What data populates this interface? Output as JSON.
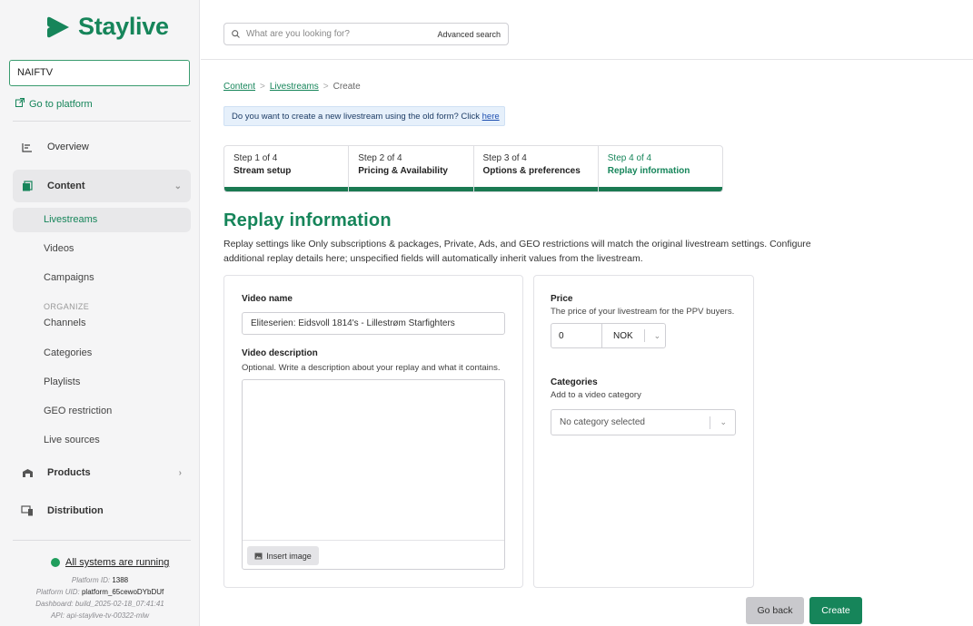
{
  "brand": {
    "name": "Staylive",
    "accent": "#16855a"
  },
  "sidebar": {
    "platform": "NAIFTV",
    "goto_label": "Go to platform",
    "overview": "Overview",
    "content": "Content",
    "sub": {
      "livestreams": "Livestreams",
      "videos": "Videos",
      "campaigns": "Campaigns",
      "organize": "ORGANIZE",
      "channels": "Channels",
      "categories": "Categories",
      "playlists": "Playlists",
      "geo": "GEO restriction",
      "live_sources": "Live sources"
    },
    "products": "Products",
    "distribution": "Distribution",
    "status": "All systems are running",
    "meta": {
      "platform_id_label": "Platform ID:",
      "platform_id": "1388",
      "platform_uid_label": "Platform UID:",
      "platform_uid": "platform_65cewoDYbDUf",
      "dashboard": "Dashboard: build_2025-02-18_07:41:41",
      "api": "API: api-staylive-tv-00322-mlw"
    }
  },
  "search": {
    "placeholder": "What are you looking for?",
    "advanced": "Advanced search"
  },
  "breadcrumb": {
    "content": "Content",
    "livestreams": "Livestreams",
    "current": "Create"
  },
  "notice": {
    "text": "Do you want to create a new livestream using the old form? Click ",
    "link": "here"
  },
  "steps": [
    {
      "num": "Step 1 of 4",
      "title": "Stream setup"
    },
    {
      "num": "Step 2 of 4",
      "title": "Pricing & Availability"
    },
    {
      "num": "Step 3 of 4",
      "title": "Options & preferences"
    },
    {
      "num": "Step 4 of 4",
      "title": "Replay information"
    }
  ],
  "page": {
    "title": "Replay information",
    "description": "Replay settings like Only subscriptions & packages, Private, Ads, and GEO restrictions will match the original livestream settings. Configure additional replay details here; unspecified fields will automatically inherit values from the livestream."
  },
  "form": {
    "video_name_label": "Video name",
    "video_name_value": "Eliteserien: Eidsvoll 1814's - Lillestrøm Starfighters",
    "video_desc_label": "Video description",
    "video_desc_hint": "Optional. Write a description about your replay and what it contains.",
    "insert_image": "Insert image",
    "price_label": "Price",
    "price_hint": "The price of your livestream for the PPV buyers.",
    "price_value": "0",
    "currency": "NOK",
    "categories_label": "Categories",
    "categories_hint": "Add to a video category",
    "categories_value": "No category selected"
  },
  "buttons": {
    "back": "Go back",
    "create": "Create"
  }
}
